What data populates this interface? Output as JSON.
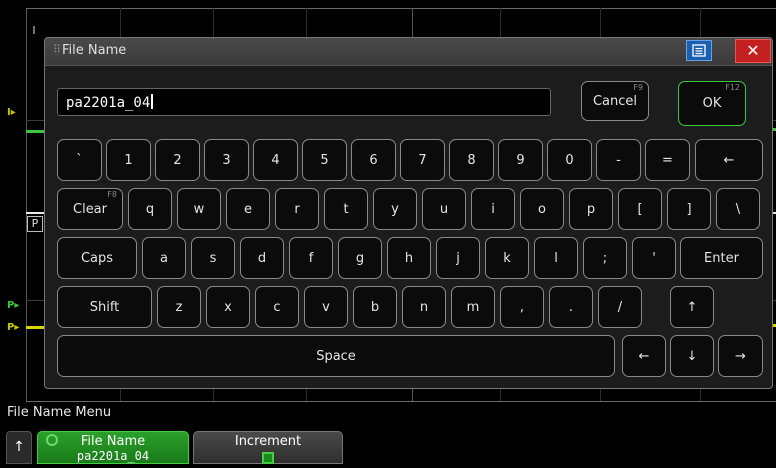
{
  "scope": {
    "label_top": "I",
    "label_mid": "P",
    "ch_marker_1": "I",
    "ch_marker_2": "P",
    "ch_marker_3": "P"
  },
  "dialog": {
    "title": "File Name",
    "input_value": "pa2201a_04"
  },
  "keys": {
    "cancel": "Cancel",
    "cancel_fkey": "F9",
    "ok": "OK",
    "ok_fkey": "F12",
    "row1": [
      "`",
      "1",
      "2",
      "3",
      "4",
      "5",
      "6",
      "7",
      "8",
      "9",
      "0",
      "-",
      "="
    ],
    "backspace": "←",
    "clear": "Clear",
    "clear_fkey": "F8",
    "row2": [
      "q",
      "w",
      "e",
      "r",
      "t",
      "y",
      "u",
      "i",
      "o",
      "p",
      "[",
      "]",
      "\\"
    ],
    "caps": "Caps",
    "row3": [
      "a",
      "s",
      "d",
      "f",
      "g",
      "h",
      "j",
      "k",
      "l",
      ";",
      "'"
    ],
    "enter": "Enter",
    "shift": "Shift",
    "row4": [
      "z",
      "x",
      "c",
      "v",
      "b",
      "n",
      "m",
      ",",
      ".",
      "/"
    ],
    "up": "↑",
    "space": "Space",
    "left": "←",
    "down": "↓",
    "right": "→"
  },
  "menu": {
    "title": "File Name Menu",
    "up_icon": "↑",
    "softkey1_title": "File Name",
    "softkey1_value": "pa2201a_04",
    "softkey2_title": "Increment"
  },
  "colors": {
    "trace_yellow": "#d8d800",
    "trace_green": "#3cc63c",
    "ok_border": "#3cc63c",
    "close_red": "#c52020",
    "menu_blue": "#1a5fb0"
  }
}
